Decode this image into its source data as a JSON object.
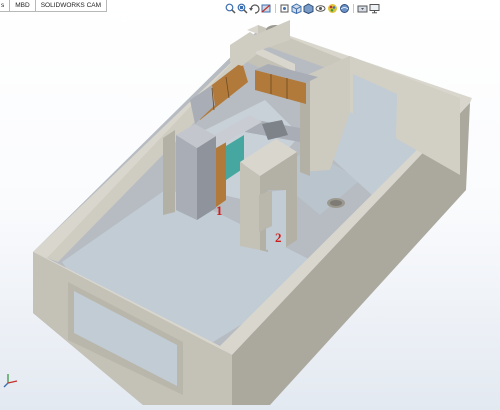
{
  "tabs": [
    {
      "label": "s"
    },
    {
      "label": "MBD"
    },
    {
      "label": "SOLIDWORKS CAM"
    }
  ],
  "toolbar": {
    "icons": [
      "zoom-to-fit-icon",
      "zoom-area-icon",
      "previous-view-icon",
      "section-view-icon",
      "dynamic-annotation-icon",
      "view-orientation-icon",
      "display-style-icon",
      "hide-show-items-icon",
      "edit-appearance-icon",
      "apply-scene-icon",
      "view-settings-icon",
      "monitor-icon"
    ]
  },
  "annotations": {
    "room1": "1",
    "room2": "2"
  },
  "colors": {
    "wall_top": "#d9d7cd",
    "wall_side": "#c4c1b6",
    "wall_shade": "#aba89e",
    "floor": "#c2ccd4",
    "cabinet_wood": "#b17a3b",
    "appliance_steel": "#a9adb5",
    "backsplash_teal": "#46a7a0",
    "label_red": "#d11c1c"
  }
}
